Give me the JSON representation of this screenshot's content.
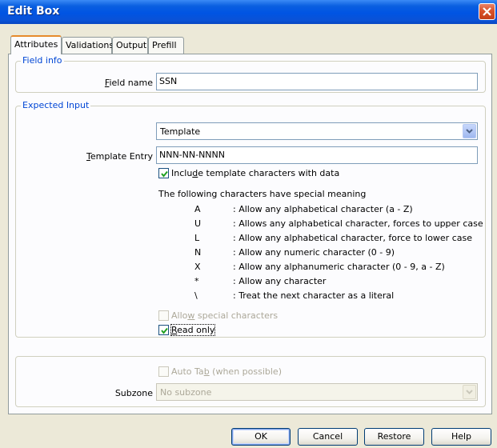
{
  "window": {
    "title": "Edit Box"
  },
  "tabs": [
    "Attributes",
    "Validations",
    "Output",
    "Prefill"
  ],
  "field_info": {
    "legend": "Field info",
    "field_name_label": "Field name",
    "field_name_value": "SSN"
  },
  "expected_input": {
    "legend": "Expected Input",
    "type_value": "Template",
    "template_entry_label": "Template Entry",
    "template_entry_value": "NNN-NN-NNNN",
    "include_template_label": "Include template characters with data",
    "include_template_checked": true,
    "special_heading": "The following characters have special meaning",
    "special_chars": [
      {
        "key": "A",
        "desc": ": Allow any alphabetical character (a - Z)"
      },
      {
        "key": "U",
        "desc": ": Allows any alphabetical character, forces to upper case"
      },
      {
        "key": "L",
        "desc": ": Allow any alphabetical character, force to lower case"
      },
      {
        "key": "N",
        "desc": ": Allow any numeric character (0 - 9)"
      },
      {
        "key": "X",
        "desc": ": Allow any alphanumeric character (0 - 9, a - Z)"
      },
      {
        "key": "*",
        "desc": ": Allow any character"
      },
      {
        "key": "\\",
        "desc": ": Treat the next character as a literal"
      }
    ],
    "allow_special_label": "Allow special characters",
    "allow_special_checked": false,
    "read_only_label": "Read only",
    "read_only_checked": true
  },
  "bottom_group": {
    "auto_tab_label": "Auto Tab (when possible)",
    "auto_tab_checked": false,
    "subzone_label": "Subzone",
    "subzone_value": "No subzone"
  },
  "buttons": {
    "ok": "OK",
    "cancel": "Cancel",
    "restore": "Restore",
    "help": "Help"
  },
  "colors": {
    "titlebar": "#0054e3",
    "group_legend": "#0046d5",
    "dialog_bg": "#ece9d8",
    "tab_highlight": "#e68b2c"
  },
  "icons": {
    "close": "close-icon",
    "dropdown": "chevron-down-icon",
    "checkmark": "checkmark-icon"
  }
}
